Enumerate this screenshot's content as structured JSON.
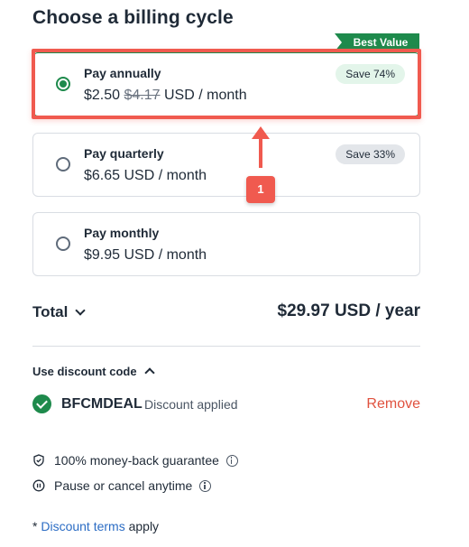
{
  "heading": "Choose a billing cycle",
  "best_value_label": "Best Value",
  "plans": [
    {
      "name": "Pay annually",
      "price": "$2.50",
      "old_price": "$4.17",
      "price_suffix": "USD / month",
      "save": "Save 74%",
      "selected": true
    },
    {
      "name": "Pay quarterly",
      "price": "$6.65 USD / month",
      "save": "Save 33%",
      "selected": false
    },
    {
      "name": "Pay monthly",
      "price": "$9.95 USD / month",
      "selected": false
    }
  ],
  "annotation": {
    "number": "1",
    "color": "#f05a4f"
  },
  "total": {
    "label": "Total",
    "value": "$29.97 USD / year"
  },
  "discount": {
    "toggle_label": "Use discount code",
    "code": "BFCMDEAL",
    "status": "Discount applied",
    "remove_label": "Remove"
  },
  "features": [
    {
      "icon": "shield-check-icon",
      "text": "100% money-back guarantee"
    },
    {
      "icon": "pause-circle-icon",
      "text": "Pause or cancel anytime"
    }
  ],
  "terms": {
    "prefix": "* ",
    "link": "Discount terms",
    "suffix": " apply"
  },
  "colors": {
    "accent_green": "#1e8a4c",
    "remove_red": "#e0523f",
    "link_blue": "#2b6cc4"
  }
}
